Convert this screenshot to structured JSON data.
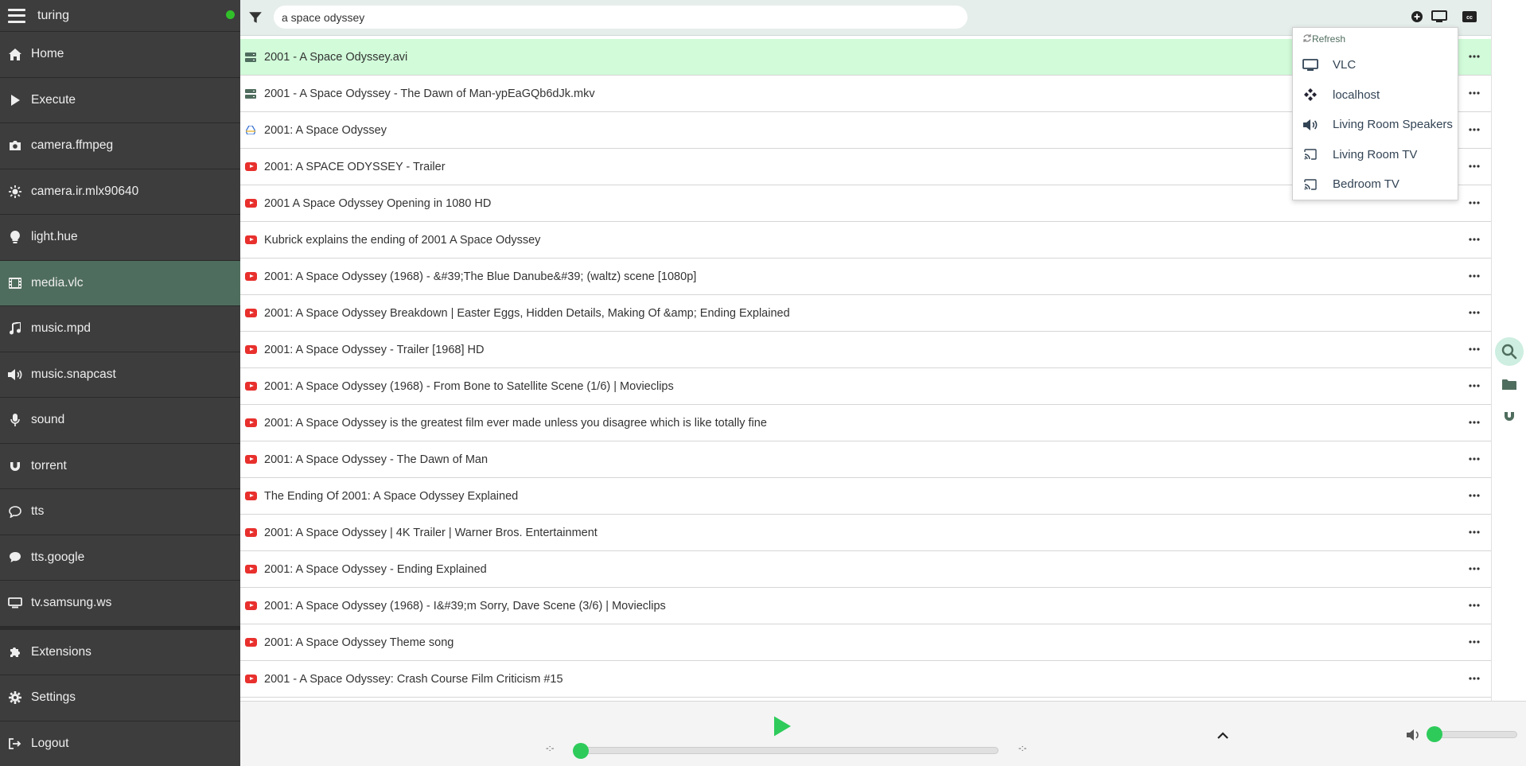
{
  "colors": {
    "sidebar_bg": "#3d3d3d",
    "active_nav": "#4f6d5e",
    "selected_row": "#d1fbd9",
    "accent_green": "#2ecb5b",
    "youtube_red": "#e8302d",
    "status_dot": "#31c02a"
  },
  "sidebar": {
    "hostname": "turing",
    "items": [
      {
        "label": "Home",
        "icon": "home-icon"
      },
      {
        "label": "Execute",
        "icon": "play-icon"
      },
      {
        "label": "camera.ffmpeg",
        "icon": "camera-icon"
      },
      {
        "label": "camera.ir.mlx90640",
        "icon": "sun-icon"
      },
      {
        "label": "light.hue",
        "icon": "lightbulb-icon"
      },
      {
        "label": "media.vlc",
        "icon": "film-icon",
        "active": true
      },
      {
        "label": "music.mpd",
        "icon": "music-icon"
      },
      {
        "label": "music.snapcast",
        "icon": "speaker-icon"
      },
      {
        "label": "sound",
        "icon": "microphone-icon"
      },
      {
        "label": "torrent",
        "icon": "magnet-icon"
      },
      {
        "label": "tts",
        "icon": "speech-bubble-icon"
      },
      {
        "label": "tts.google",
        "icon": "speech-bubble-filled-icon"
      },
      {
        "label": "tv.samsung.ws",
        "icon": "tv-icon"
      }
    ],
    "footer": [
      {
        "label": "Extensions",
        "icon": "puzzle-icon"
      },
      {
        "label": "Settings",
        "icon": "gear-icon"
      },
      {
        "label": "Logout",
        "icon": "logout-icon"
      }
    ]
  },
  "search": {
    "value": "a space odyssey"
  },
  "results": [
    {
      "title": "2001 - A Space Odyssey.avi",
      "type": "file",
      "selected": true
    },
    {
      "title": "2001 - A Space Odyssey - The Dawn of Man-ypEaGQb6dJk.mkv",
      "type": "file"
    },
    {
      "title": "2001: A Space Odyssey",
      "type": "drive"
    },
    {
      "title": "2001: A SPACE ODYSSEY - Trailer",
      "type": "youtube"
    },
    {
      "title": "2001 A Space Odyssey Opening in 1080 HD",
      "type": "youtube"
    },
    {
      "title": "Kubrick explains the ending of 2001 A Space Odyssey",
      "type": "youtube"
    },
    {
      "title": "2001: A Space Odyssey (1968) - &#39;The Blue Danube&#39; (waltz) scene [1080p]",
      "type": "youtube"
    },
    {
      "title": "2001: A Space Odyssey Breakdown | Easter Eggs, Hidden Details, Making Of &amp; Ending Explained",
      "type": "youtube"
    },
    {
      "title": "2001: A Space Odyssey - Trailer [1968] HD",
      "type": "youtube"
    },
    {
      "title": "2001: A Space Odyssey (1968) - From Bone to Satellite Scene (1/6) | Movieclips",
      "type": "youtube"
    },
    {
      "title": "2001: A Space Odyssey is the greatest film ever made unless you disagree which is like totally fine",
      "type": "youtube"
    },
    {
      "title": "2001: A Space Odyssey - The Dawn of Man",
      "type": "youtube"
    },
    {
      "title": "The Ending Of 2001: A Space Odyssey Explained",
      "type": "youtube"
    },
    {
      "title": "2001: A Space Odyssey | 4K Trailer | Warner Bros. Entertainment",
      "type": "youtube"
    },
    {
      "title": "2001: A Space Odyssey - Ending Explained",
      "type": "youtube"
    },
    {
      "title": "2001: A Space Odyssey (1968) - I&#39;m Sorry, Dave Scene (3/6) | Movieclips",
      "type": "youtube"
    },
    {
      "title": "2001: A Space Odyssey Theme song",
      "type": "youtube"
    },
    {
      "title": "2001 - A Space Odyssey: Crash Course Film Criticism #15",
      "type": "youtube"
    }
  ],
  "dropdown": {
    "header": "Refresh",
    "items": [
      {
        "label": "VLC",
        "icon": "monitor-icon"
      },
      {
        "label": "localhost",
        "icon": "kodi-icon"
      },
      {
        "label": "Living Room Speakers",
        "icon": "speaker-icon"
      },
      {
        "label": "Living Room TV",
        "icon": "cast-icon"
      },
      {
        "label": "Bedroom TV",
        "icon": "cast-icon"
      }
    ]
  },
  "player": {
    "elapsed": "-:-",
    "duration": "-:-",
    "progress": 0,
    "volume": 0
  }
}
